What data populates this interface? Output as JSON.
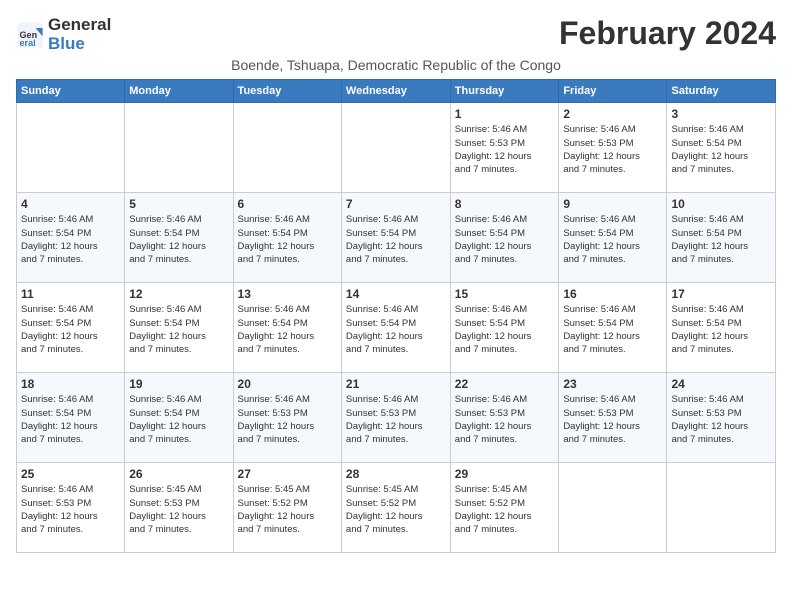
{
  "logo": {
    "general": "General",
    "blue": "Blue"
  },
  "title": "February 2024",
  "subtitle": "Boende, Tshuapa, Democratic Republic of the Congo",
  "days_of_week": [
    "Sunday",
    "Monday",
    "Tuesday",
    "Wednesday",
    "Thursday",
    "Friday",
    "Saturday"
  ],
  "weeks": [
    [
      {
        "day": "",
        "info": ""
      },
      {
        "day": "",
        "info": ""
      },
      {
        "day": "",
        "info": ""
      },
      {
        "day": "",
        "info": ""
      },
      {
        "day": "1",
        "info": "Sunrise: 5:46 AM\nSunset: 5:53 PM\nDaylight: 12 hours\nand 7 minutes."
      },
      {
        "day": "2",
        "info": "Sunrise: 5:46 AM\nSunset: 5:53 PM\nDaylight: 12 hours\nand 7 minutes."
      },
      {
        "day": "3",
        "info": "Sunrise: 5:46 AM\nSunset: 5:54 PM\nDaylight: 12 hours\nand 7 minutes."
      }
    ],
    [
      {
        "day": "4",
        "info": "Sunrise: 5:46 AM\nSunset: 5:54 PM\nDaylight: 12 hours\nand 7 minutes."
      },
      {
        "day": "5",
        "info": "Sunrise: 5:46 AM\nSunset: 5:54 PM\nDaylight: 12 hours\nand 7 minutes."
      },
      {
        "day": "6",
        "info": "Sunrise: 5:46 AM\nSunset: 5:54 PM\nDaylight: 12 hours\nand 7 minutes."
      },
      {
        "day": "7",
        "info": "Sunrise: 5:46 AM\nSunset: 5:54 PM\nDaylight: 12 hours\nand 7 minutes."
      },
      {
        "day": "8",
        "info": "Sunrise: 5:46 AM\nSunset: 5:54 PM\nDaylight: 12 hours\nand 7 minutes."
      },
      {
        "day": "9",
        "info": "Sunrise: 5:46 AM\nSunset: 5:54 PM\nDaylight: 12 hours\nand 7 minutes."
      },
      {
        "day": "10",
        "info": "Sunrise: 5:46 AM\nSunset: 5:54 PM\nDaylight: 12 hours\nand 7 minutes."
      }
    ],
    [
      {
        "day": "11",
        "info": "Sunrise: 5:46 AM\nSunset: 5:54 PM\nDaylight: 12 hours\nand 7 minutes."
      },
      {
        "day": "12",
        "info": "Sunrise: 5:46 AM\nSunset: 5:54 PM\nDaylight: 12 hours\nand 7 minutes."
      },
      {
        "day": "13",
        "info": "Sunrise: 5:46 AM\nSunset: 5:54 PM\nDaylight: 12 hours\nand 7 minutes."
      },
      {
        "day": "14",
        "info": "Sunrise: 5:46 AM\nSunset: 5:54 PM\nDaylight: 12 hours\nand 7 minutes."
      },
      {
        "day": "15",
        "info": "Sunrise: 5:46 AM\nSunset: 5:54 PM\nDaylight: 12 hours\nand 7 minutes."
      },
      {
        "day": "16",
        "info": "Sunrise: 5:46 AM\nSunset: 5:54 PM\nDaylight: 12 hours\nand 7 minutes."
      },
      {
        "day": "17",
        "info": "Sunrise: 5:46 AM\nSunset: 5:54 PM\nDaylight: 12 hours\nand 7 minutes."
      }
    ],
    [
      {
        "day": "18",
        "info": "Sunrise: 5:46 AM\nSunset: 5:54 PM\nDaylight: 12 hours\nand 7 minutes."
      },
      {
        "day": "19",
        "info": "Sunrise: 5:46 AM\nSunset: 5:54 PM\nDaylight: 12 hours\nand 7 minutes."
      },
      {
        "day": "20",
        "info": "Sunrise: 5:46 AM\nSunset: 5:53 PM\nDaylight: 12 hours\nand 7 minutes."
      },
      {
        "day": "21",
        "info": "Sunrise: 5:46 AM\nSunset: 5:53 PM\nDaylight: 12 hours\nand 7 minutes."
      },
      {
        "day": "22",
        "info": "Sunrise: 5:46 AM\nSunset: 5:53 PM\nDaylight: 12 hours\nand 7 minutes."
      },
      {
        "day": "23",
        "info": "Sunrise: 5:46 AM\nSunset: 5:53 PM\nDaylight: 12 hours\nand 7 minutes."
      },
      {
        "day": "24",
        "info": "Sunrise: 5:46 AM\nSunset: 5:53 PM\nDaylight: 12 hours\nand 7 minutes."
      }
    ],
    [
      {
        "day": "25",
        "info": "Sunrise: 5:46 AM\nSunset: 5:53 PM\nDaylight: 12 hours\nand 7 minutes."
      },
      {
        "day": "26",
        "info": "Sunrise: 5:45 AM\nSunset: 5:53 PM\nDaylight: 12 hours\nand 7 minutes."
      },
      {
        "day": "27",
        "info": "Sunrise: 5:45 AM\nSunset: 5:52 PM\nDaylight: 12 hours\nand 7 minutes."
      },
      {
        "day": "28",
        "info": "Sunrise: 5:45 AM\nSunset: 5:52 PM\nDaylight: 12 hours\nand 7 minutes."
      },
      {
        "day": "29",
        "info": "Sunrise: 5:45 AM\nSunset: 5:52 PM\nDaylight: 12 hours\nand 7 minutes."
      },
      {
        "day": "",
        "info": ""
      },
      {
        "day": "",
        "info": ""
      }
    ]
  ]
}
